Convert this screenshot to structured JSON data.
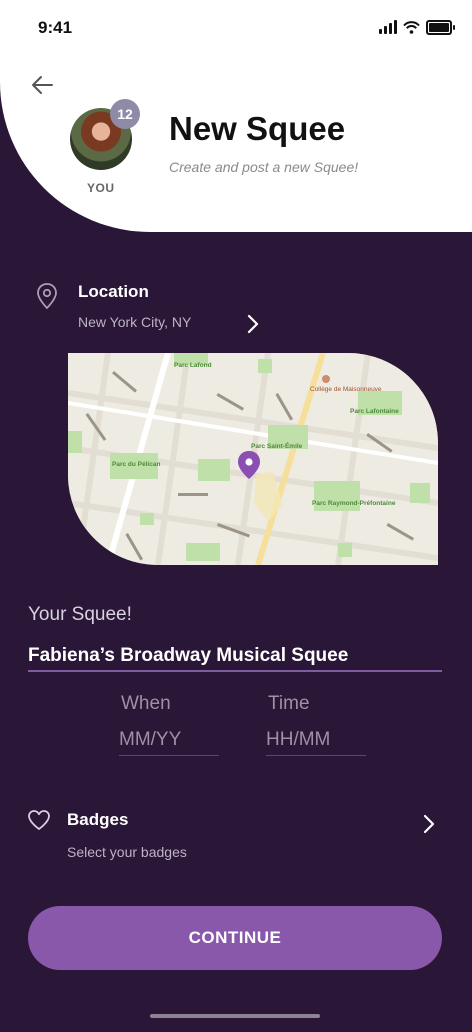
{
  "status_bar": {
    "time": "9:41"
  },
  "header": {
    "title": "New Squee",
    "subtitle": "Create and post a new Squee!",
    "avatar_badge": "12",
    "avatar_label": "YOU"
  },
  "location": {
    "label": "Location",
    "value": "New York City, NY"
  },
  "map_labels": {
    "park_1": "Parc Lafond",
    "park_2": "Parc Lafontaine",
    "park_3": "Parc Saint-Émile",
    "park_4": "Parc du Pélican",
    "park_5": "Parc Raymond-Préfontaine",
    "college": "Collège de Maisonneuve"
  },
  "squee": {
    "label": "Your Squee!",
    "value": "Fabiena’s Broadway Musical Squee"
  },
  "schedule": {
    "when_label": "When",
    "when_placeholder": "MM/YY",
    "time_label": "Time",
    "time_placeholder": "HH/MM"
  },
  "badges": {
    "label": "Badges",
    "sub": "Select your badges"
  },
  "continue_label": "CONTINUE",
  "colors": {
    "background": "#2a1636",
    "accent": "#8a58ab",
    "map_pin": "#8a4fb0"
  }
}
